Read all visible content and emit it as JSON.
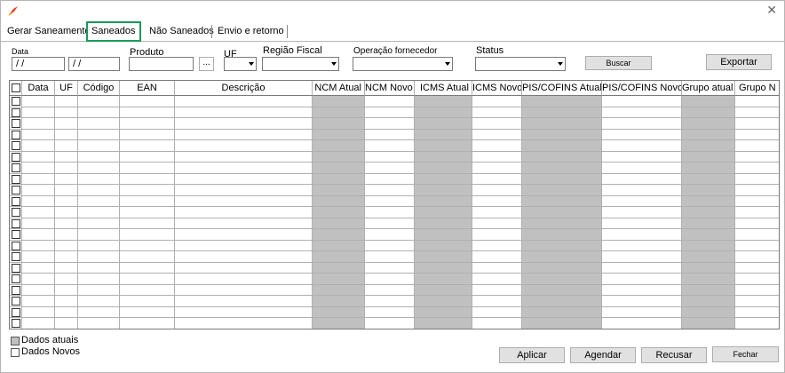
{
  "tabs": [
    {
      "label": "Gerar Saneamento"
    },
    {
      "label": "Saneados"
    },
    {
      "label": "Não Saneados"
    },
    {
      "label": "Envio e retorno"
    }
  ],
  "filters": {
    "data_label": "Data",
    "date_from": " / /",
    "date_to": " / /",
    "produto_label": "Produto",
    "produto_value": "",
    "produto_button": "...",
    "uf_label": "UF",
    "regiao_label": "Região Fiscal",
    "operacao_label": "Operação fornecedor",
    "status_label": "Status",
    "buscar_button": "Buscar",
    "exportar_button": "Exportar"
  },
  "table": {
    "columns": [
      "Data",
      "UF",
      "Código",
      "EAN",
      "Descrição",
      "NCM Atual",
      "NCM Novo",
      "ICMS Atual",
      "ICMS Novo",
      "PIS/COFINS Atual",
      "PIS/COFINS Novo",
      "Grupo atual",
      "Grupo N"
    ],
    "row_count": 21,
    "shaded_color": "#c0c0c0"
  },
  "legend": {
    "atuais": "Dados atuais",
    "novos": "Dados Novos",
    "atuais_color": "#c0c0c0",
    "novos_color": "#ffffff"
  },
  "actions": {
    "aplicar": "Aplicar",
    "agendar": "Agendar",
    "recusar": "Recusar",
    "fechar": "Fechar"
  },
  "accent_color": "#1a9a5a"
}
